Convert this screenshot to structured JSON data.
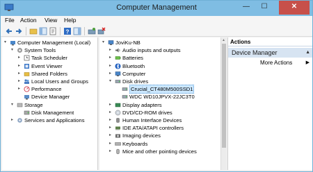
{
  "window": {
    "title": "Computer Management"
  },
  "menu": [
    {
      "label": "File"
    },
    {
      "label": "Action"
    },
    {
      "label": "View"
    },
    {
      "label": "Help"
    }
  ],
  "toolbar": {
    "icons": [
      "back-arrow-icon",
      "forward-arrow-icon",
      "up-folder-icon",
      "show-hide-tree-icon",
      "properties-icon",
      "help-icon",
      "show-hide-action-pane-icon",
      "scan-hardware-icon",
      "uninstall-device-icon"
    ]
  },
  "left_tree": [
    {
      "label": "Computer Management (Local)",
      "icon": "computer-management-icon",
      "expander": "▾",
      "level": 0
    },
    {
      "label": "System Tools",
      "icon": "system-tools-icon",
      "expander": "▾",
      "level": 1
    },
    {
      "label": "Task Scheduler",
      "icon": "task-scheduler-icon",
      "expander": "▸",
      "level": 2
    },
    {
      "label": "Event Viewer",
      "icon": "event-viewer-icon",
      "expander": "▸",
      "level": 2
    },
    {
      "label": "Shared Folders",
      "icon": "shared-folders-icon",
      "expander": "▸",
      "level": 2
    },
    {
      "label": "Local Users and Groups",
      "icon": "local-users-icon",
      "expander": "▸",
      "level": 2
    },
    {
      "label": "Performance",
      "icon": "performance-icon",
      "expander": "▸",
      "level": 2
    },
    {
      "label": "Device Manager",
      "icon": "device-manager-icon",
      "expander": "",
      "level": 2
    },
    {
      "label": "Storage",
      "icon": "storage-icon",
      "expander": "▾",
      "level": 1
    },
    {
      "label": "Disk Management",
      "icon": "disk-management-icon",
      "expander": "",
      "level": 2
    },
    {
      "label": "Services and Applications",
      "icon": "services-icon",
      "expander": "▸",
      "level": 1
    }
  ],
  "device_tree": [
    {
      "label": "JoviKu-NB",
      "icon": "computer-icon",
      "expander": "▾",
      "level": 0
    },
    {
      "label": "Audio inputs and outputs",
      "icon": "audio-icon",
      "expander": "▸",
      "level": 1
    },
    {
      "label": "Batteries",
      "icon": "battery-icon",
      "expander": "▸",
      "level": 1
    },
    {
      "label": "Bluetooth",
      "icon": "bluetooth-icon",
      "expander": "▸",
      "level": 1
    },
    {
      "label": "Computer",
      "icon": "computer-icon",
      "expander": "▸",
      "level": 1
    },
    {
      "label": "Disk drives",
      "icon": "disk-drive-icon",
      "expander": "▾",
      "level": 1
    },
    {
      "label": "Crucial_CT480M500SSD1",
      "icon": "disk-drive-icon",
      "expander": "",
      "level": 2,
      "selected": true
    },
    {
      "label": "WDC WD10JPVX-22JC3T0",
      "icon": "disk-drive-icon",
      "expander": "",
      "level": 2
    },
    {
      "label": "Display adapters",
      "icon": "display-adapter-icon",
      "expander": "▸",
      "level": 1
    },
    {
      "label": "DVD/CD-ROM drives",
      "icon": "dvd-drive-icon",
      "expander": "▸",
      "level": 1
    },
    {
      "label": "Human Interface Devices",
      "icon": "hid-icon",
      "expander": "▸",
      "level": 1
    },
    {
      "label": "IDE ATA/ATAPI controllers",
      "icon": "ide-controller-icon",
      "expander": "▸",
      "level": 1
    },
    {
      "label": "Imaging devices",
      "icon": "camera-icon",
      "expander": "▸",
      "level": 1
    },
    {
      "label": "Keyboards",
      "icon": "keyboard-icon",
      "expander": "▸",
      "level": 1
    },
    {
      "label": "Mice and other pointing devices",
      "icon": "mouse-icon",
      "expander": "▸",
      "level": 1
    }
  ],
  "actions": {
    "header": "Actions",
    "section": "Device Manager",
    "item": "More Actions"
  }
}
